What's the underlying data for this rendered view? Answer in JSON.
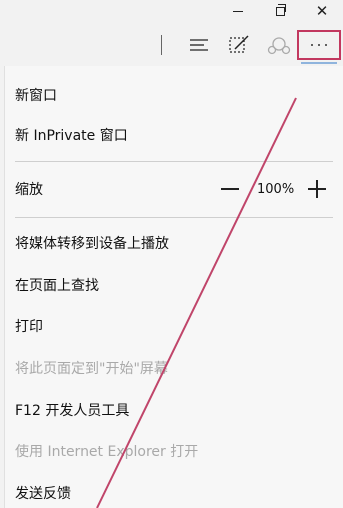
{
  "window": {
    "minimize_icon": "minimize-icon",
    "maximize_icon": "restore-icon",
    "close_glyph": "✕"
  },
  "toolbar": {
    "hub_icon": "hub-icon",
    "note_icon": "web-note-icon",
    "share_icon": "share-icon",
    "more_icon": "more-actions-icon",
    "highlight_color": "#c2385f"
  },
  "menu": {
    "new_window": "新窗口",
    "new_inprivate": "新 InPrivate 窗口",
    "zoom_label": "缩放",
    "zoom_value": "100%",
    "cast_media": "将媒体转移到设备上播放",
    "find_on_page": "在页面上查找",
    "print": "打印",
    "pin_start": "将此页面定到\"开始\"屏幕",
    "f12_tools": "F12 开发人员工具",
    "open_ie": "使用 Internet Explorer 打开",
    "feedback": "发送反馈"
  },
  "annotation": {
    "line_color": "#c0456a"
  }
}
